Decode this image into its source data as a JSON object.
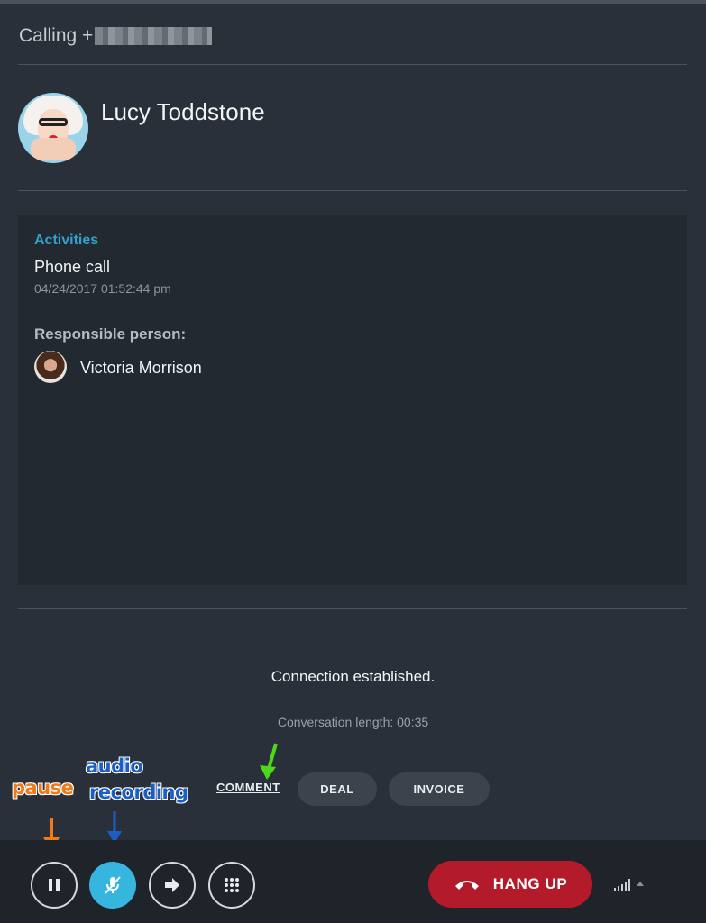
{
  "header": {
    "calling_label": "Calling +"
  },
  "contact": {
    "name": "Lucy Toddstone"
  },
  "card": {
    "title": "Activities",
    "activity_name": "Phone call",
    "activity_date": "04/24/2017 01:52:44 pm",
    "responsible_label": "Responsible person:",
    "responsible_name": "Victoria Morrison"
  },
  "status": {
    "connection": "Connection established.",
    "length": "Conversation length: 00:35"
  },
  "actions": {
    "comment": "COMMENT",
    "deal": "DEAL",
    "invoice": "INVOICE"
  },
  "annotations": {
    "pause": "pause",
    "audio_line1": "audio",
    "audio_line2": "recording"
  },
  "controls": {
    "hangup": "HANG UP"
  },
  "colors": {
    "accent": "#2fa3cc",
    "record_active": "#36b6df",
    "hangup": "#b31b2b",
    "annotation_orange": "#f07a1a",
    "annotation_blue": "#1a5fc5",
    "annotation_green": "#4cd91a"
  },
  "icons": [
    "pause-icon",
    "mic-off-icon",
    "transfer-arrow-icon",
    "keypad-icon",
    "phone-hangup-icon",
    "signal-icon",
    "caret-up-icon"
  ]
}
